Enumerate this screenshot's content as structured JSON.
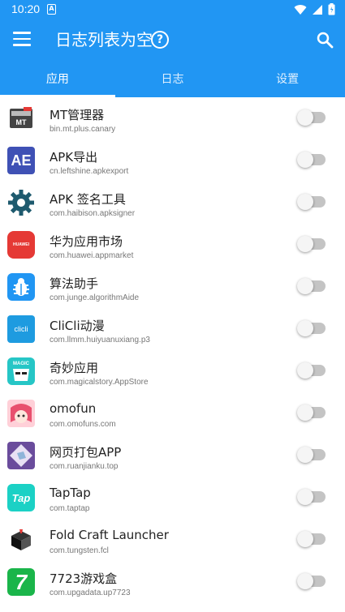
{
  "status_bar": {
    "time": "10:20",
    "sim_label": "A"
  },
  "app_bar": {
    "title": "日志列表为空",
    "help_label": "?"
  },
  "tabs": [
    {
      "label": "应用",
      "active": true
    },
    {
      "label": "日志",
      "active": false
    },
    {
      "label": "设置",
      "active": false
    }
  ],
  "apps": [
    {
      "name": "MT管理器",
      "package": "bin.mt.plus.canary",
      "enabled": false,
      "icon": "mt-manager-icon",
      "icon_text": "MT",
      "icon_bg": "#ffffff"
    },
    {
      "name": "APK导出",
      "package": "cn.leftshine.apkexport",
      "enabled": false,
      "icon": "apk-export-icon",
      "icon_text": "AE",
      "icon_bg": "#3f51b5"
    },
    {
      "name": "APK 签名工具",
      "package": "com.haibison.apksigner",
      "enabled": false,
      "icon": "gear-icon",
      "icon_text": "",
      "icon_bg": "#ffffff"
    },
    {
      "name": "华为应用市场",
      "package": "com.huawei.appmarket",
      "enabled": false,
      "icon": "huawei-icon",
      "icon_text": "HUAWEI",
      "icon_bg": "#e53935"
    },
    {
      "name": "算法助手",
      "package": "com.junge.algorithmAide",
      "enabled": false,
      "icon": "bug-icon",
      "icon_text": "",
      "icon_bg": "#2196f3"
    },
    {
      "name": "CliCli动漫",
      "package": "com.llmm.huiyuanuxiang.p3",
      "enabled": false,
      "icon": "clicli-icon",
      "icon_text": "clicli",
      "icon_bg": "#1e9be0"
    },
    {
      "name": "奇妙应用",
      "package": "com.magicalstory.AppStore",
      "enabled": false,
      "icon": "magic-icon",
      "icon_text": "MAGIC",
      "icon_bg": "#26c6c6"
    },
    {
      "name": "omofun",
      "package": "com.omofuns.com",
      "enabled": false,
      "icon": "omofun-icon",
      "icon_text": "",
      "icon_bg": "#ffd0d8"
    },
    {
      "name": "网页打包APP",
      "package": "com.ruanjianku.top",
      "enabled": false,
      "icon": "web-pack-icon",
      "icon_text": "",
      "icon_bg": "#6a4c9c"
    },
    {
      "name": "TapTap",
      "package": "com.taptap",
      "enabled": false,
      "icon": "taptap-icon",
      "icon_text": "Tap",
      "icon_bg": "#1bd1c5"
    },
    {
      "name": "Fold Craft Launcher",
      "package": "com.tungsten.fcl",
      "enabled": false,
      "icon": "fcl-icon",
      "icon_text": "",
      "icon_bg": "#ffffff"
    },
    {
      "name": "7723游戏盒",
      "package": "com.upgadata.up7723",
      "enabled": false,
      "icon": "7723-icon",
      "icon_text": "7",
      "icon_bg": "#1ab54a"
    }
  ],
  "colors": {
    "primary": "#2196f3",
    "toggle_off_track": "#c4c4c4"
  }
}
